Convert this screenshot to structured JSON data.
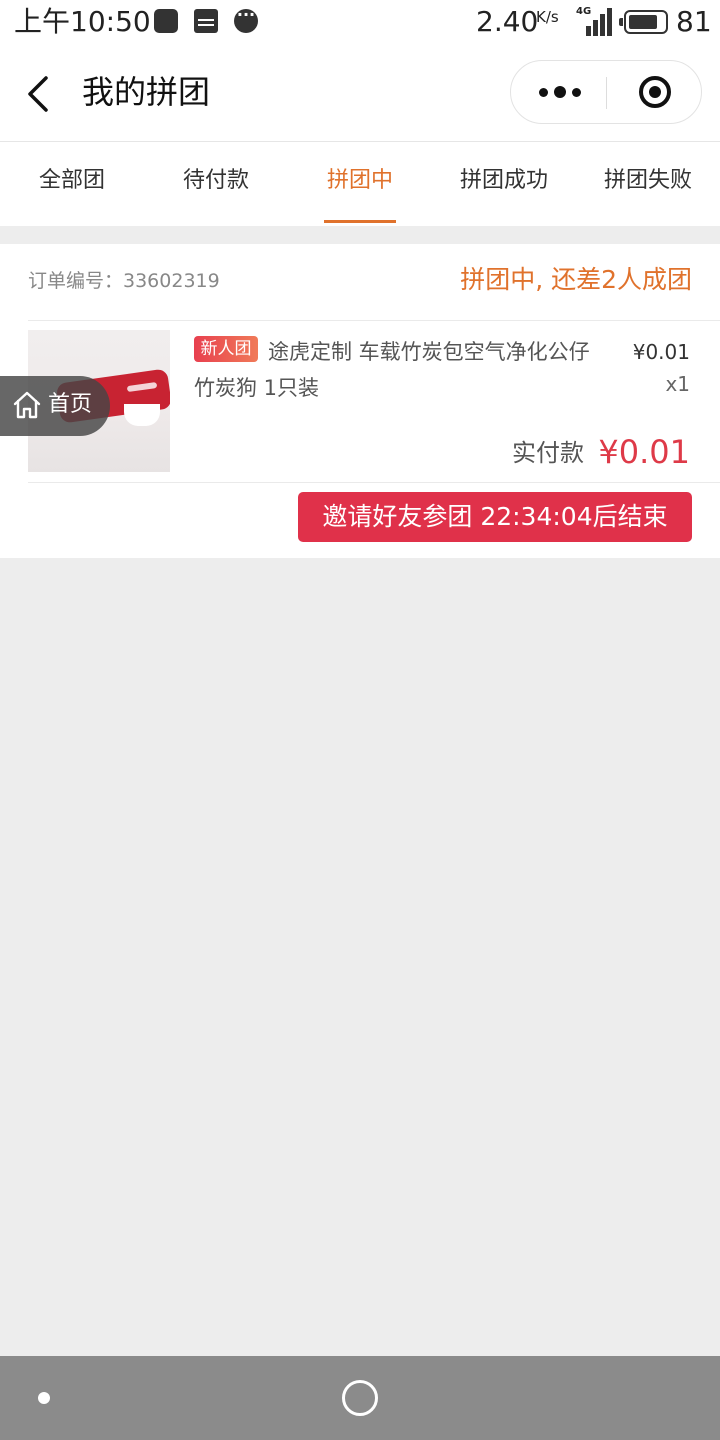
{
  "status_bar": {
    "time": "上午10:50",
    "notification_icons": [
      "qq-icon",
      "news-icon",
      "message-icon"
    ],
    "net_speed": "2.40",
    "net_speed_unit": "K/s",
    "signal_label": "4G",
    "battery_level": "81"
  },
  "nav": {
    "title": "我的拼团"
  },
  "tabs": [
    {
      "label": "全部团",
      "active": false
    },
    {
      "label": "待付款",
      "active": false
    },
    {
      "label": "拼团中",
      "active": true
    },
    {
      "label": "拼团成功",
      "active": false
    },
    {
      "label": "拼团失败",
      "active": false
    }
  ],
  "order": {
    "order_no_label": "订单编号：33602319",
    "status": "拼团中, 还差2人成团",
    "tag": "新人团",
    "product_title": "途虎定制 车载竹炭包空气净化公仔竹炭狗 1只装",
    "unit_price": "¥0.01",
    "quantity": "x1",
    "paid_label": "实付款",
    "paid_amount": "¥0.01",
    "invite_button": "邀请好友参团 22:34:04后结束"
  },
  "float_home": {
    "label": "首页"
  },
  "colors": {
    "accent_orange": "#e0722c",
    "price_red": "#de3a48",
    "button_red": "#e0314a"
  }
}
